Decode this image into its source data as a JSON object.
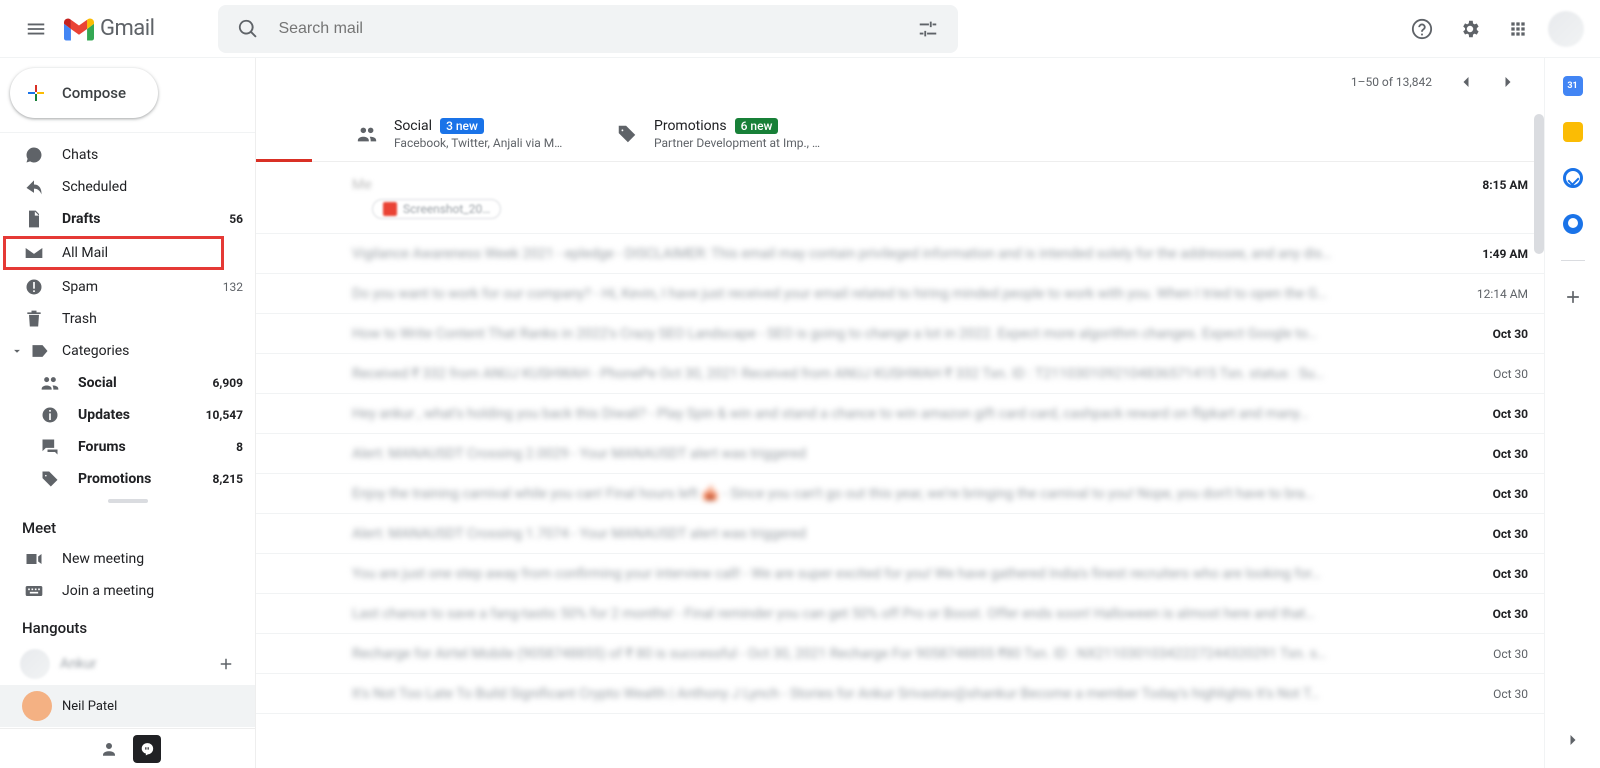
{
  "header": {
    "product": "Gmail",
    "search_placeholder": "Search mail"
  },
  "compose_label": "Compose",
  "nav": {
    "chats": "Chats",
    "scheduled": "Scheduled",
    "drafts": "Drafts",
    "drafts_count": "56",
    "allmail": "All Mail",
    "spam": "Spam",
    "spam_count": "132",
    "trash": "Trash",
    "categories": "Categories",
    "social": "Social",
    "social_count": "6,909",
    "updates": "Updates",
    "updates_count": "10,547",
    "forums": "Forums",
    "forums_count": "8",
    "promotions": "Promotions",
    "promotions_count": "8,215"
  },
  "meet": {
    "heading": "Meet",
    "new": "New meeting",
    "join": "Join a meeting"
  },
  "hangouts": {
    "heading": "Hangouts",
    "blurred_name": "Ankur",
    "neil": "Neil Patel"
  },
  "toolbar": {
    "page_info": "1–50 of 13,842"
  },
  "tabs": {
    "social": {
      "label": "Social",
      "badge": "3 new",
      "subtitle": "Facebook, Twitter, Anjali via M…"
    },
    "promotions": {
      "label": "Promotions",
      "badge": "6 new",
      "subtitle": "Partner Development at Imp., …"
    }
  },
  "rows": [
    {
      "subject": "Me",
      "attachment": "Screenshot_20…",
      "time": "8:15 AM",
      "bold": true
    },
    {
      "subject": "Vigilance Awareness Week 2021 - epledge - DISCLAIMER: This email may contain privileged information and is intended solely for the addressee, and any dis…",
      "time": "1:49 AM",
      "bold": true
    },
    {
      "subject": "Do you want to work for our company? - Hi, Kevin, I have just received your email related to hiring minded people to work with you. When I tried to open the G…",
      "time": "12:14 AM",
      "bold": false
    },
    {
      "subject": "How to Write Content That Ranks in 2022's Crazy SEO Landscape - SEO is going to change a lot in 2022. Expect more algorithm changes. Expect Google to…",
      "time": "Oct 30",
      "bold": true
    },
    {
      "subject": "Received ₹ 332 from ANUJ KUSHWAH - PhonePe Oct 30, 2021 Received from ANUJ KUSHWAH ₹ 332 Txn. ID : T2110301092104836571415 Txn. status : Su…",
      "time": "Oct 30",
      "bold": false
    },
    {
      "subject": "Hey ankur , what's holding you back this Diwali? - Play Spin & win and stand a chance to win amazon gift card card, cashpack reward on flipkart and many…",
      "time": "Oct 30",
      "bold": true
    },
    {
      "subject": "Alert: MANAUSDT Crossing 2.0029 - Your MANAUSDT alert was triggered",
      "time": "Oct 30",
      "bold": true
    },
    {
      "subject": "Enjoy the training carnival while you can! Final hours left 🎪 - Since you can't go out this year, we're bringing the carnival to you! Nope, you don't have to bra…",
      "time": "Oct 30",
      "bold": true
    },
    {
      "subject": "Alert: MANAUSDT Crossing 1.7074 - Your MANAUSDT alert was triggered",
      "time": "Oct 30",
      "bold": true
    },
    {
      "subject": "You are just one step away from confirming your interview call! - We are super excited for you! We have gathered India's finest recruiters who are looking for…",
      "time": "Oct 30",
      "bold": true
    },
    {
      "subject": "Last chance to save a fang-tastic 50% for 2 months! - Final reminder you can get 50% off Pro or Boost. Offer ends soon! Halloween is almost here and that…",
      "time": "Oct 30",
      "bold": true
    },
    {
      "subject": "Recharge for Airtel Mobile (9058748855) of ₹ 80 is successful - Oct 30, 2021 Recharge For 9058748855 ₹80 Txn. ID : NX21103010342227244320291 Txn. s…",
      "time": "Oct 30",
      "bold": false
    },
    {
      "subject": "It's Not Too Late To Build Significant Crypto Wealth | Anthony J Lynch - Stories for Ankur Srivastav@shankur Become a member Today's highlights It's Not T…",
      "time": "Oct 30",
      "bold": false
    }
  ]
}
